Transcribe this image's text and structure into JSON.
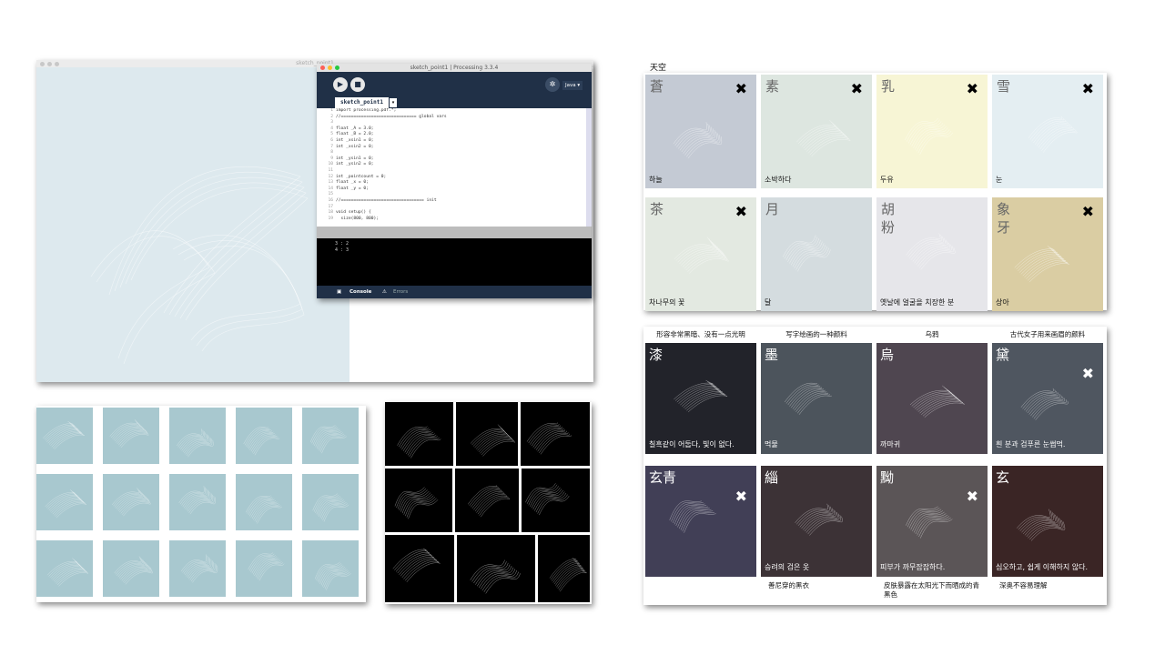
{
  "sketch_window": {
    "title": "sketch_point1"
  },
  "ide": {
    "title": "sketch_point1 | Processing 3.3.4",
    "mode": "Java ▾",
    "tab": "sketch_point1",
    "tab_arrow": "▾",
    "code": "import processing.pdf.*;\n//============================== global vars\n\nfloat _A = 3.0;\nfloat _B = 2.0;\nint _xsin1 = 0;\nint _xsin2 = 0;\n\nint _ysin1 = 0;\nint _ysin2 = 0;\n\nint _pointcount = 0;\nfloat _x = 0;\nfloat _y = 0;\n\n//================================= init\n\nvoid setup() {\n  size(800, 800);",
    "line_numbers": "1\n2\n3\n4\n5\n6\n7\n8\n9\n10\n11\n12\n13\n14\n15\n16\n17\n18\n19",
    "console_output": "3 : 2\n4 : 3",
    "console_tab": "Console",
    "errors_tab": "Errors"
  },
  "tian_card": {
    "title": "天空",
    "tiles": [
      {
        "char": "蒼",
        "label": "하늘",
        "color": "#c4cad4",
        "x": true
      },
      {
        "char": "素",
        "label": "소박하다",
        "color": "#dde6e0",
        "x": true
      },
      {
        "char": "乳",
        "label": "두유",
        "color": "#f7f5d5",
        "x": true
      },
      {
        "char": "雪",
        "label": "눈",
        "color": "#e4eef2",
        "x": true
      },
      {
        "char": "茶",
        "label": "차나무의 꽃",
        "color": "#e3e9e1",
        "x": true
      },
      {
        "char": "月",
        "label": "달",
        "color": "#d4dcdf",
        "x": false
      },
      {
        "char": "胡粉",
        "label": "옛날에 얼굴을 치장한 분",
        "color": "#e6e6ea",
        "x": false
      },
      {
        "char": "象牙",
        "label": "상아",
        "color": "#dacda3",
        "x": true
      }
    ]
  },
  "dark_card": {
    "top_captions": [
      "形容非常黑暗、没有一点光明",
      "写字绘画的一种颜料",
      "乌鸦",
      "古代女子用来画眉的颜料"
    ],
    "tiles": [
      {
        "char": "漆",
        "label": "칠흑같이 어둡다, 빛이 없다.",
        "color": "#22232a",
        "x": false
      },
      {
        "char": "墨",
        "label": "먹물",
        "color": "#4c545c",
        "x": false
      },
      {
        "char": "烏",
        "label": "까마귀",
        "color": "#4f4650",
        "x": false
      },
      {
        "char": "黛",
        "label": "흰 분과 검푸른 눈썹먹.",
        "color": "#4f5660",
        "x": true
      },
      {
        "char": "玄青",
        "label": "",
        "color": "#413f56",
        "x": true
      },
      {
        "char": "緇",
        "label": "승려의 검은 옷",
        "color": "#3c3236",
        "x": false
      },
      {
        "char": "黝",
        "label": "피부가 까무잡잡하다.",
        "color": "#5b5557",
        "x": true
      },
      {
        "char": "玄",
        "label": "심오하고, 쉽게 이해하지 않다.",
        "color": "#3a2525",
        "x": false
      }
    ],
    "bottom_captions": [
      "善尼穿的黑衣",
      "皮肤暴露在太阳光下而晒成的青黑色",
      "深奥不容易理解"
    ]
  }
}
